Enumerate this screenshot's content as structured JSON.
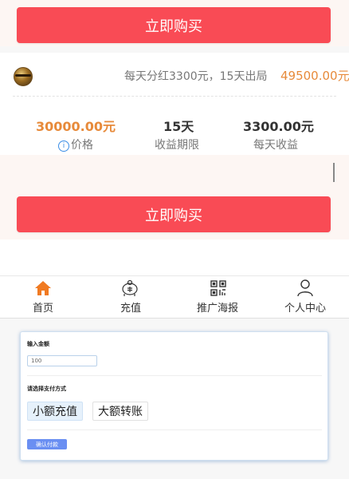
{
  "buy_label": "立即购买",
  "product": {
    "description": "每天分红3300元，15天出局",
    "top_price": "49500.00元",
    "stats": [
      {
        "value": "30000.00元",
        "label": "价格",
        "color": "#e78a3a"
      },
      {
        "value": "15天",
        "label": "收益期限",
        "color": "#333333"
      },
      {
        "value": "3300.00元",
        "label": "每天收益",
        "color": "#333333"
      }
    ]
  },
  "tabbar": {
    "items": [
      {
        "label": "首页",
        "icon": "home-icon",
        "active": true
      },
      {
        "label": "充值",
        "icon": "piggy-bank-icon",
        "active": false
      },
      {
        "label": "推广海报",
        "icon": "qr-code-icon",
        "active": false
      },
      {
        "label": "个人中心",
        "icon": "user-icon",
        "active": false
      }
    ]
  },
  "payment": {
    "amount_label": "输入金额",
    "amount_value": "100",
    "method_label": "请选择支付方式",
    "methods": [
      "小额充值",
      "大额转账"
    ],
    "confirm_label": "确认付款"
  },
  "colors": {
    "accent_red": "#f94b55",
    "accent_orange": "#e78a3a",
    "confirm_blue": "#6a8ff2"
  }
}
